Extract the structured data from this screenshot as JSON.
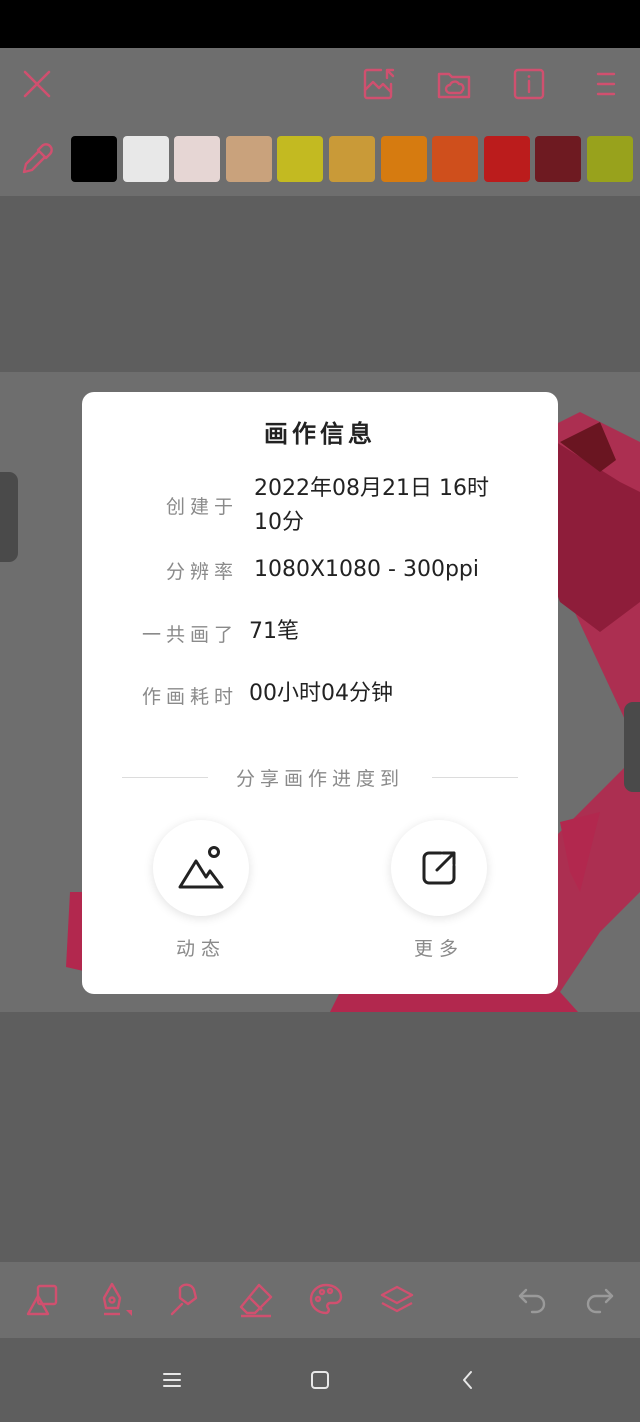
{
  "toolbar": {
    "icons": [
      "close-icon",
      "import-image-icon",
      "cloud-folder-icon",
      "info-icon",
      "menu-icon"
    ]
  },
  "palette": {
    "colors": [
      "#000000",
      "#e8e8e8",
      "#e6d6d4",
      "#c9a27c",
      "#c3ba21",
      "#c99a38",
      "#d67b10",
      "#cf4f1c",
      "#bb1c1c",
      "#6e1a21",
      "#98a21c"
    ]
  },
  "dialog": {
    "title": "画作信息",
    "created_label": "创建于",
    "created_value": "2022年08月21日 16时10分",
    "resolution_label": "分辨率",
    "resolution_value": "1080X1080 - 300ppi",
    "strokes_label": "一共画了",
    "strokes_value": "71笔",
    "duration_label": "作画耗时",
    "duration_value": "00小时04分钟",
    "share_heading": "分享画作进度到",
    "share_moments_label": "动态",
    "share_more_label": "更多"
  },
  "bottom_toolbar": {
    "icons": [
      "shapes-icon",
      "pen-icon",
      "smudge-icon",
      "eraser-icon",
      "palette-icon",
      "layers-icon",
      "undo-icon",
      "redo-icon"
    ]
  },
  "nav": {
    "icons": [
      "recents-icon",
      "home-icon",
      "back-icon"
    ]
  },
  "colors": {
    "accent": "#d0506f",
    "artwork": "#b2284e"
  }
}
